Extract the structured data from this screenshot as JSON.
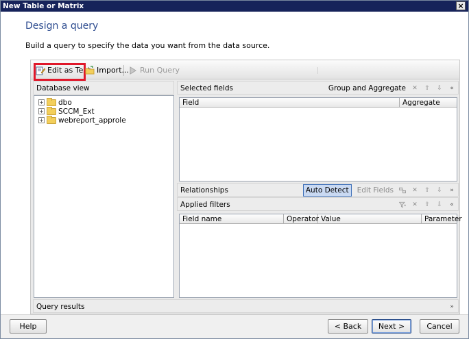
{
  "window": {
    "title": "New Table or Matrix",
    "close_glyph": "×"
  },
  "page": {
    "heading": "Design a query",
    "instructions": "Build a query to specify the data you want from the data source."
  },
  "toolbar": {
    "edit_as_text": "Edit as Text",
    "import": "Import...",
    "run_query": "Run Query"
  },
  "database_view": {
    "title": "Database view",
    "items": [
      {
        "label": "dbo",
        "expander": "+"
      },
      {
        "label": "SCCM_Ext",
        "expander": "+"
      },
      {
        "label": "webreport_approle",
        "expander": "+"
      }
    ]
  },
  "selected_fields": {
    "title": "Selected fields",
    "group_and_aggregate": "Group and Aggregate",
    "columns": [
      "Field",
      "Aggregate"
    ]
  },
  "relationships": {
    "title": "Relationships",
    "auto_detect": "Auto Detect",
    "edit_fields": "Edit Fields"
  },
  "applied_filters": {
    "title": "Applied filters",
    "columns": [
      "Field name",
      "Operator",
      "Value",
      "Parameter"
    ]
  },
  "query_results": {
    "title": "Query results"
  },
  "footer": {
    "help": "Help",
    "back": "< Back",
    "next": "Next >",
    "cancel": "Cancel"
  },
  "glyphs": {
    "delete": "✕",
    "up": "⇧",
    "down": "⇩",
    "collapse": "«",
    "expand": "»"
  },
  "colors": {
    "title_bar": "#16235a",
    "heading": "#2b4a8e",
    "highlight": "#e0182a",
    "auto_detect_bg": "#c9d9f2"
  }
}
